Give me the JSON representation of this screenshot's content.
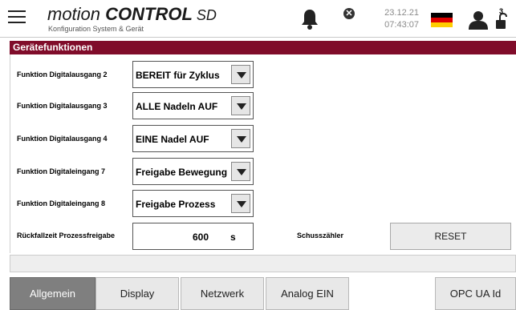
{
  "header": {
    "brand_part1": "motion ",
    "brand_part2": "CONTROL",
    "brand_part3": " SD",
    "subtitle": "Konfiguration System & Gerät",
    "date": "23.12.21",
    "time": "07:43:07",
    "error_glyph": "✕",
    "lock_badge": "3",
    "icons": [
      "menu-icon",
      "bell-icon",
      "error-icon",
      "flag-germany-icon",
      "user-icon",
      "lock-icon"
    ]
  },
  "section": {
    "title": "Gerätefunktionen"
  },
  "settings": {
    "rows": [
      {
        "label": "Funktion Digitalausgang 2",
        "value": "BEREIT für Zyklus"
      },
      {
        "label": "Funktion Digitalausgang 3",
        "value": "ALLE Nadeln AUF"
      },
      {
        "label": "Funktion Digitalausgang 4",
        "value": "EINE Nadel AUF"
      },
      {
        "label": "Funktion Digitaleingang 7",
        "value": "Freigabe Bewegung"
      },
      {
        "label": "Funktion Digitaleingang 8",
        "value": "Freigabe Prozess"
      }
    ],
    "fallback": {
      "label": "Rückfallzeit Prozessfreigabe",
      "value": "600",
      "unit": "s"
    },
    "counter_label": "Schusszähler",
    "reset_label": "RESET"
  },
  "tabs": [
    {
      "label": "Allgemein",
      "active": true
    },
    {
      "label": "Display",
      "active": false
    },
    {
      "label": "Netzwerk",
      "active": false
    },
    {
      "label": "Analog EIN",
      "active": false
    },
    {
      "label": "OPC UA Id",
      "active": false
    }
  ],
  "colors": {
    "titlebar": "#800c2a",
    "active_tab": "#7f7f7f",
    "tab": "#e8e8e8"
  }
}
